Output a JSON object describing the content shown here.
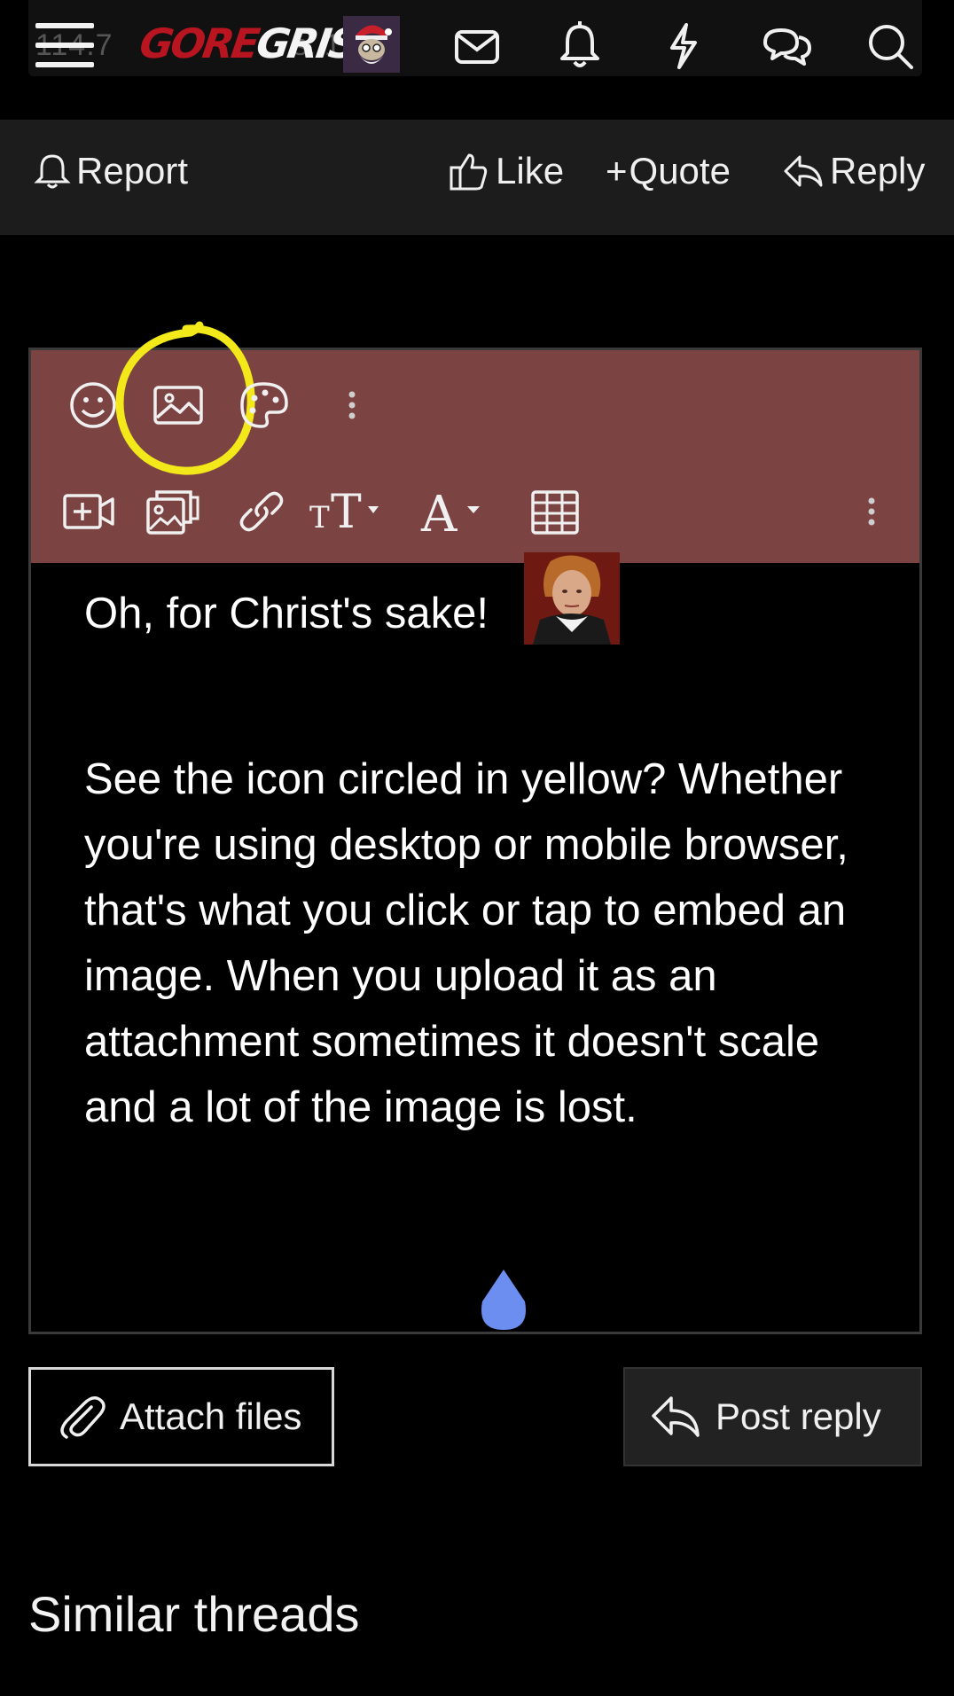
{
  "header": {
    "ghost_text_left": "114.7",
    "ghost_text_right": "s: 1",
    "logo_part1": "GORE",
    "logo_part2": "GRISH",
    "icons": [
      "menu-icon",
      "envelope-icon",
      "bell-icon",
      "lightning-icon",
      "chat-bubbles-icon",
      "search-icon"
    ]
  },
  "actions": {
    "report": "Report",
    "like": "Like",
    "quote": "Quote",
    "reply": "Reply"
  },
  "editor": {
    "toolbar_row1": [
      "smiley-icon",
      "image-icon",
      "palette-icon",
      "more-vertical-icon"
    ],
    "toolbar_row2": [
      "video-add-icon",
      "gallery-icon",
      "link-icon",
      "text-size-icon",
      "font-icon",
      "table-icon",
      "more-vertical-icon"
    ],
    "text_line1": "Oh, for Christ's sake!",
    "text_para2": "See the icon circled in yellow? Whether you're using desktop or mobile browser, that's what you click or tap to embed an image. When you upload it as an attachment sometimes it doesn't scale and a lot of the image is lost."
  },
  "buttons": {
    "attach": "Attach files",
    "post": "Post reply"
  },
  "similar_threads": "Similar threads",
  "colors": {
    "toolbar_bg": "#7c4343",
    "highlight": "#f2e81a",
    "logo_red": "#b81520",
    "drop_handle": "#6b8ef0"
  }
}
